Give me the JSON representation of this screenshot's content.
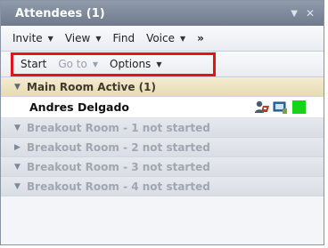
{
  "panel": {
    "title": "Attendees (1)"
  },
  "menubar": {
    "items": [
      {
        "label": "Invite"
      },
      {
        "label": "View"
      },
      {
        "label": "Find"
      },
      {
        "label": "Voice"
      }
    ],
    "more_label": "»"
  },
  "toolbar": {
    "start_label": "Start",
    "goto_label": "Go to",
    "options_label": "Options"
  },
  "groups": [
    {
      "label": "Main Room Active (1)",
      "state": "active",
      "expanded": true
    },
    {
      "label": "Breakout Room - 1 not started",
      "state": "inactive",
      "expanded": true
    },
    {
      "label": "Breakout Room - 2 not started",
      "state": "inactive",
      "expanded": false
    },
    {
      "label": "Breakout Room - 3 not started",
      "state": "inactive",
      "expanded": true
    },
    {
      "label": "Breakout Room - 4 not started",
      "state": "inactive",
      "expanded": true
    }
  ],
  "attendees": [
    {
      "name": "Andres Delgado",
      "status_color": "#18d418"
    }
  ],
  "colors": {
    "highlight": "#e5121b",
    "status_available": "#18d418"
  }
}
